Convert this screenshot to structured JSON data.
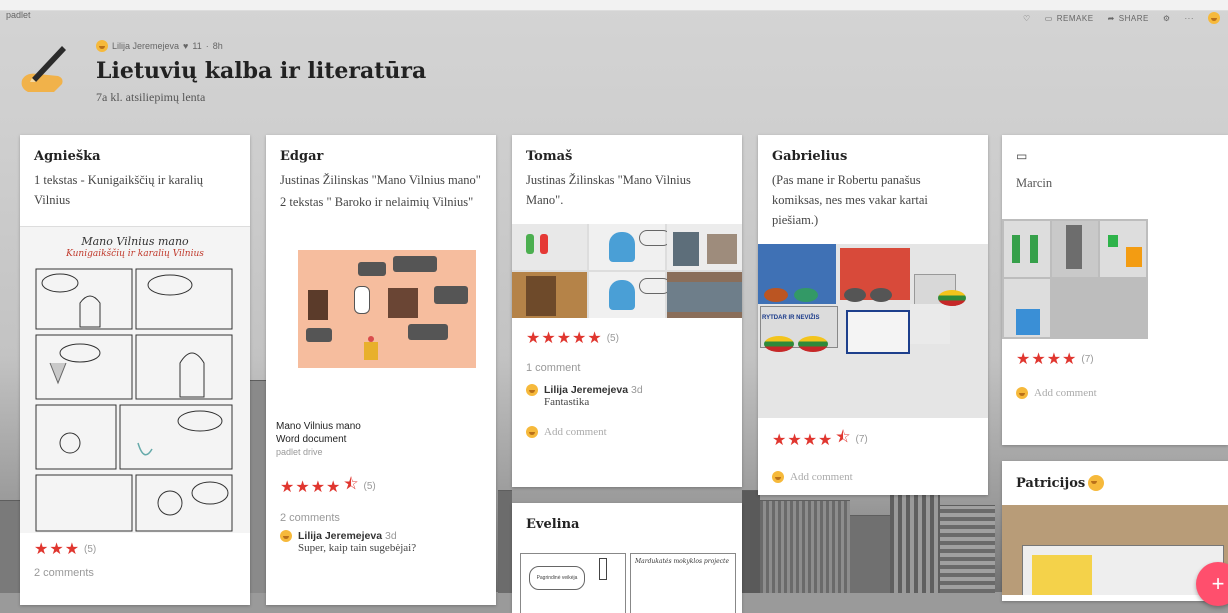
{
  "header": {
    "app_tag": "padlet",
    "author": "Lilija Jeremejeva",
    "likes": "11",
    "age": "8h",
    "title": "Lietuvių kalba ir literatūra",
    "subtitle": "7a kl. atsiliepimų lenta",
    "actions": {
      "remake": "REMAKE",
      "share": "SHARE",
      "more": "···"
    }
  },
  "colors": {
    "accent": "#e0362f",
    "fab": "#ff4f6d"
  },
  "cards": [
    {
      "name": "Agnieška",
      "text": "1 tekstas - Kunigaikščių ir karalių Vilnius",
      "image_caption_1": "Mano Vilnius mano",
      "image_caption_2": "Kunigaikščių ir karalių Vilnius",
      "stars": "★★★",
      "rating_count": "(5)",
      "comments": "2 comments"
    },
    {
      "name": "Edgar",
      "text_1": "Justinas Žilinskas \"Mano Vilnius mano\"",
      "text_2": "2 tekstas \" Baroko ir nelaimių Vilnius\"",
      "doc_title": "Mano Vilnius mano",
      "doc_type": "Word document",
      "doc_source": "padlet drive",
      "stars": "★★★★",
      "half": "⯪",
      "rating_count": "(5)",
      "comments": "2 comments",
      "commenter": "Lilija Jeremejeva",
      "comment_time": "3d",
      "comment_text": "Super, kaip tain sugebėjai?"
    },
    {
      "name": "Tomaš",
      "text": "Justinas Žilinskas \"Mano Vilnius Mano\".",
      "stars": "★★★★★",
      "rating_count": "(5)",
      "comments": "1 comment",
      "commenter": "Lilija Jeremejeva",
      "comment_time": "3d",
      "comment_text": "Fantastika",
      "add_comment": "Add comment"
    },
    {
      "name": "Gabrielius",
      "text": "(Pas mane ir Robertu panašus komiksas, nes mes vakar kartai piešiam.)",
      "image_text": "RYTDAR IR NEVIŽIS",
      "stars": "★★★★",
      "half": "⯪",
      "rating_count": "(7)",
      "add_comment": "Add comment"
    },
    {
      "name": "Marcin",
      "stars": "★★★★",
      "rating_count": "(7)",
      "add_comment": "Add comment"
    },
    {
      "name": "Evelina",
      "caption_1": "Pagrindinė veikėja",
      "caption_2": "Mardukatės mokyklos projecte"
    },
    {
      "name": "Patricijos"
    }
  ],
  "fab_label": "+"
}
